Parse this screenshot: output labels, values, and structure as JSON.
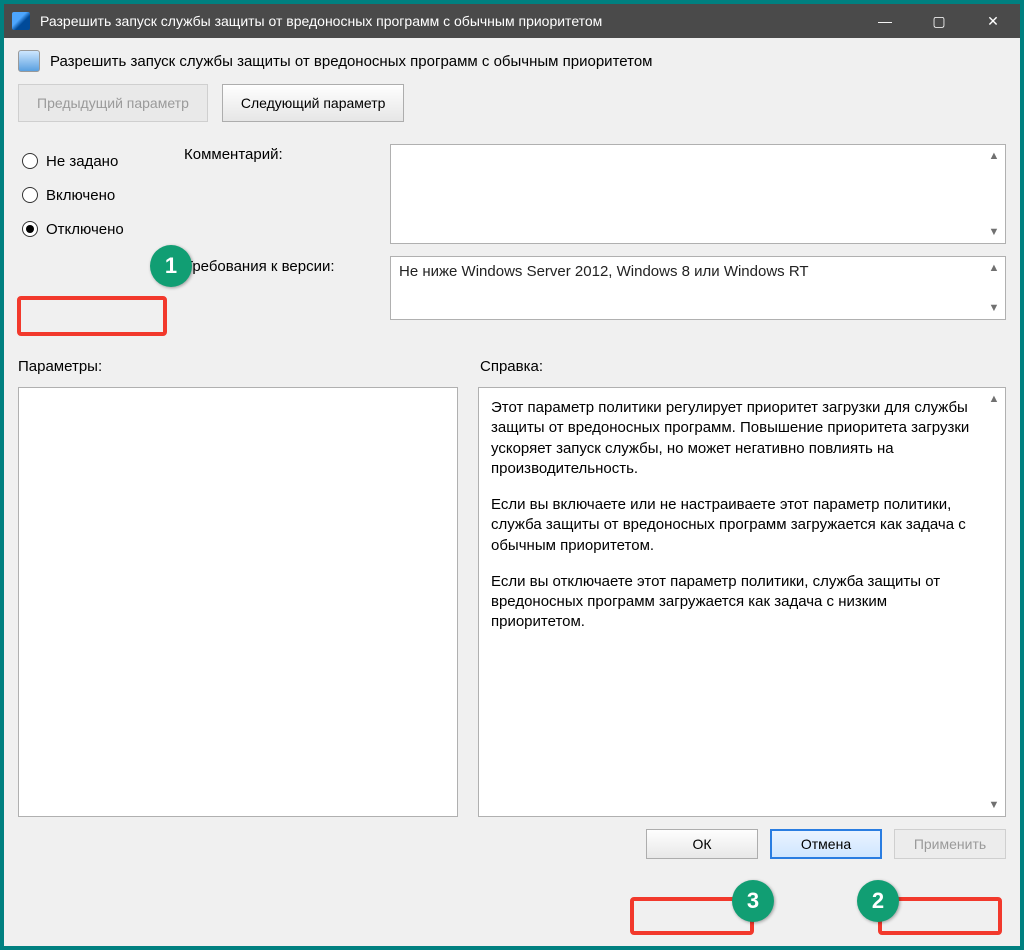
{
  "titlebar": {
    "title": "Разрешить запуск службы защиты от вредоносных программ с обычным приоритетом"
  },
  "header": {
    "title": "Разрешить запуск службы защиты от вредоносных программ с обычным приоритетом"
  },
  "nav": {
    "prev": "Предыдущий параметр",
    "next": "Следующий параметр"
  },
  "state": {
    "radios": {
      "not_configured": "Не задано",
      "enabled": "Включено",
      "disabled": "Отключено",
      "selected": "disabled"
    }
  },
  "labels": {
    "comment": "Комментарий:",
    "requirements": "Требования к версии:",
    "parameters": "Параметры:",
    "help": "Справка:"
  },
  "values": {
    "comment": "",
    "requirements": "Не ниже Windows Server 2012, Windows 8 или Windows RT"
  },
  "help": {
    "p1": "Этот параметр политики регулирует приоритет загрузки для службы защиты от вредоносных программ. Повышение приоритета загрузки ускоряет запуск службы, но может негативно повлиять на производительность.",
    "p2": "Если вы включаете или не настраиваете этот параметр политики, служба защиты от вредоносных программ загружается как задача с обычным приоритетом.",
    "p3": "Если вы отключаете этот параметр политики, служба защиты от вредоносных программ загружается как задача с низким приоритетом."
  },
  "buttons": {
    "ok": "ОК",
    "cancel": "Отмена",
    "apply": "Применить"
  },
  "callouts": {
    "c1": "1",
    "c2": "2",
    "c3": "3"
  }
}
